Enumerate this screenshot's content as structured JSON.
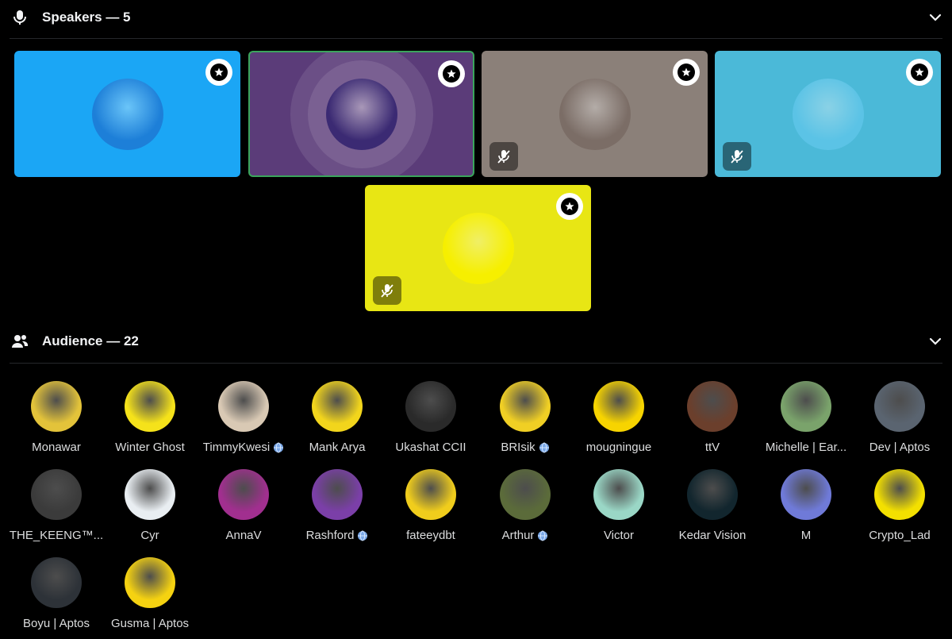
{
  "speakers": {
    "title": "Speakers — 5",
    "tiles": [
      {
        "bg": "#1ba6f5",
        "avatar_bg": "#1d7fd8",
        "muted": false,
        "active": false
      },
      {
        "bg": "#5b3c79",
        "avatar_bg": "#3b2a73",
        "muted": false,
        "active": true
      },
      {
        "bg": "#8b8079",
        "avatar_bg": "#7b6d66",
        "muted": true,
        "active": false
      },
      {
        "bg": "#4bb9d8",
        "avatar_bg": "#5bc3e6",
        "muted": true,
        "active": false
      },
      {
        "bg": "#e8e614",
        "avatar_bg": "#f6ef00",
        "muted": true,
        "active": false
      }
    ]
  },
  "audience": {
    "title": "Audience — 22",
    "members": [
      {
        "name": "Monawar",
        "color": "#e3c33a",
        "globe": false
      },
      {
        "name": "Winter Ghost",
        "color": "#f5e21a",
        "globe": false
      },
      {
        "name": "TimmyKwesi",
        "color": "#d9c9b4",
        "globe": true
      },
      {
        "name": "Mank Arya",
        "color": "#f2d51c",
        "globe": false
      },
      {
        "name": "Ukashat CCII",
        "color": "#2a2a2a",
        "globe": false
      },
      {
        "name": "BRIsik",
        "color": "#f0cf24",
        "globe": true
      },
      {
        "name": "mougningue",
        "color": "#f7d400",
        "globe": false
      },
      {
        "name": "ttV",
        "color": "#6b3f2c",
        "globe": false
      },
      {
        "name": "Michelle | Ear...",
        "color": "#7aa36b",
        "globe": false
      },
      {
        "name": "Dev | Aptos",
        "color": "#5a6470",
        "globe": false
      },
      {
        "name": "THE_KEENG™...",
        "color": "#3b3b3b",
        "globe": false
      },
      {
        "name": "Cyr",
        "color": "#e9eef2",
        "globe": false
      },
      {
        "name": "AnnaV",
        "color": "#a12f8f",
        "globe": false
      },
      {
        "name": "Rashford",
        "color": "#7b3fa8",
        "globe": true
      },
      {
        "name": "fateeydbt",
        "color": "#f0cd1c",
        "globe": false
      },
      {
        "name": "Arthur",
        "color": "#5b6b3a",
        "globe": true
      },
      {
        "name": "Victor",
        "color": "#9ad7c6",
        "globe": false
      },
      {
        "name": "Kedar Vision",
        "color": "#12262e",
        "globe": false
      },
      {
        "name": "M",
        "color": "#6f7ad8",
        "globe": false
      },
      {
        "name": "Crypto_Lad",
        "color": "#f3e000",
        "globe": false
      },
      {
        "name": "Boyu | Aptos",
        "color": "#2d3238",
        "globe": false
      },
      {
        "name": "Gusma | Aptos",
        "color": "#f5d211",
        "globe": false
      }
    ]
  }
}
